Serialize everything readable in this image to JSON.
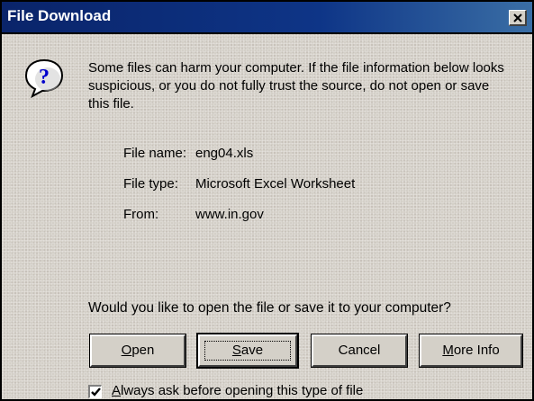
{
  "window": {
    "title": "File Download",
    "close_label": "x"
  },
  "message": "Some files can harm your computer. If the file information below looks suspicious, or you do not fully trust the source, do not open or save this file.",
  "file_info": {
    "name_label": "File name:",
    "name_value": "eng04.xls",
    "type_label": "File type:",
    "type_value": "Microsoft Excel Worksheet",
    "from_label": "From:",
    "from_value": "www.in.gov"
  },
  "prompt": "Would you like to open the file or save it to your computer?",
  "buttons": {
    "open_accel": "O",
    "open_rest": "pen",
    "save_accel": "S",
    "save_rest": "ave",
    "cancel": "Cancel",
    "more_accel": "M",
    "more_rest": "ore Info"
  },
  "checkbox": {
    "label_accel": "A",
    "label_rest": "lways ask before opening this type of file",
    "checked": true
  },
  "icons": {
    "question": "question-icon",
    "close": "close-icon",
    "check": "checkmark-icon"
  },
  "colors": {
    "titlebar": "#0a246a",
    "face": "#d4d0c8"
  }
}
